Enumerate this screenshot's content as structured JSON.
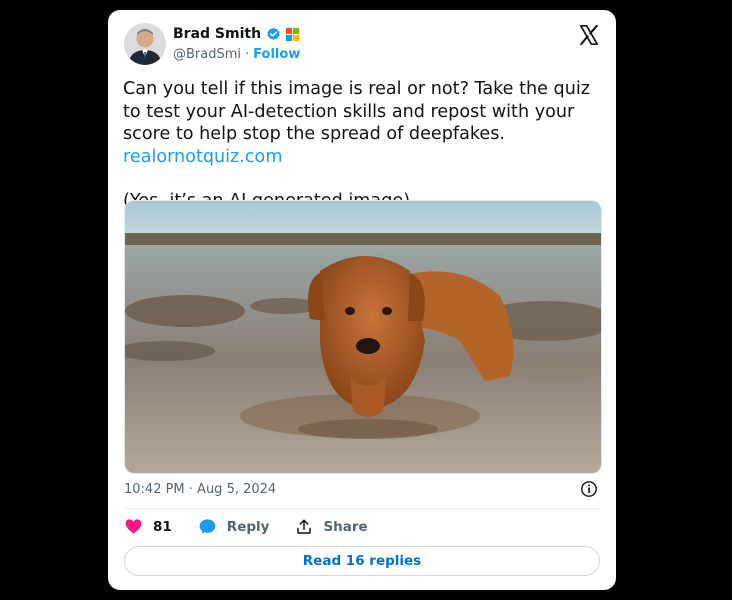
{
  "tweet": {
    "author": {
      "name": "Brad Smith",
      "handle": "@BradSmi",
      "follow_label": "Follow"
    },
    "text": {
      "line1_plain": "Can you tell if this image is real or not? Take the quiz to test your AI-detection skills and repost with your score to help stop the spread of deepfakes. ",
      "link": "realornotquiz.com",
      "line2": "(Yes, it’s an AI generated image)"
    },
    "media": {
      "icon": "ai-generated-dog-photo"
    },
    "timestamp": "10:42 PM · Aug 5, 2024",
    "actions": {
      "likes_count": "81",
      "reply_label": "Reply",
      "share_label": "Share"
    },
    "read_replies_label": "Read 16 replies"
  },
  "colors": {
    "background": "#000000",
    "card": "#ffffff",
    "accent": "#1d9bf0",
    "like": "#f91880",
    "text_primary": "#0f1419",
    "text_secondary": "#536471"
  }
}
